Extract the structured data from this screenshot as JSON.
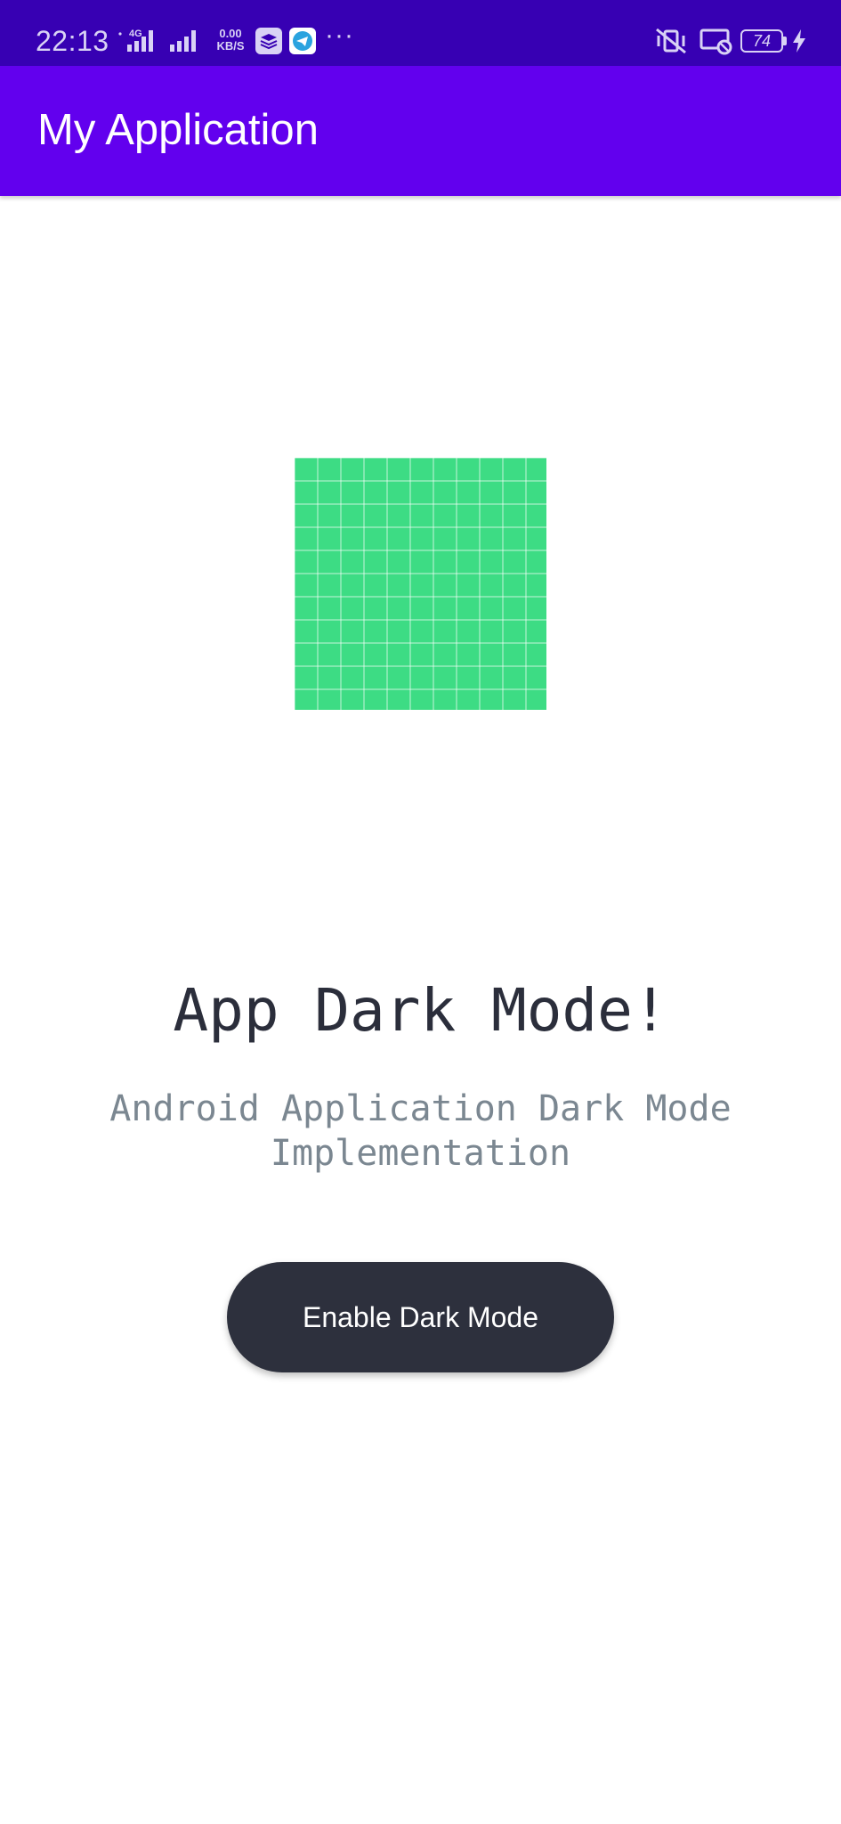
{
  "status_bar": {
    "time": "22:13",
    "network_type": "4G",
    "net_speed_value": "0.00",
    "net_speed_unit": "KB/S",
    "more_indicator": "···",
    "battery_level": "74",
    "icons": [
      "signal-icon",
      "signal-icon",
      "layers-app-icon",
      "telegram-icon",
      "vibrate-off-icon",
      "cast-off-icon",
      "battery-icon",
      "charging-icon"
    ]
  },
  "app_bar": {
    "title": "My Application",
    "color": "#6200ee"
  },
  "main": {
    "image_icon": "android-grid-image",
    "image_color": "#3ddc84",
    "headline": "App Dark Mode!",
    "subtitle": "Android Application Dark Mode Implementation",
    "button_label": "Enable Dark Mode",
    "button_color": "#2d303d"
  },
  "colors": {
    "status_bar": "#3700b3",
    "app_bar": "#6200ee",
    "background": "#ffffff",
    "headline_text": "#2b2e3b",
    "subtitle_text": "#7b8791"
  }
}
